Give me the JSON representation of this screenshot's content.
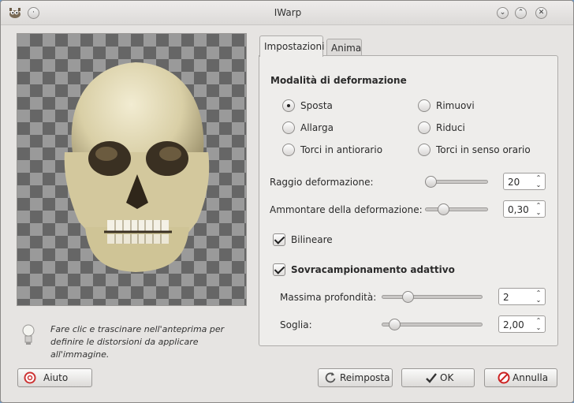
{
  "window": {
    "title": "IWarp"
  },
  "preview": {
    "hint": "Fare clic e trascinare nell'anteprima per definire le distorsioni da applicare all'immagine."
  },
  "tabs": [
    {
      "label": "Impostazioni",
      "active": true
    },
    {
      "label": "Anima",
      "active": false
    }
  ],
  "deform_mode": {
    "title": "Modalità di deformazione",
    "options": [
      {
        "label": "Sposta",
        "checked": true
      },
      {
        "label": "Rimuovi",
        "checked": false
      },
      {
        "label": "Allarga",
        "checked": false
      },
      {
        "label": "Riduci",
        "checked": false
      },
      {
        "label": "Torci in antiorario",
        "checked": false
      },
      {
        "label": "Torci in senso orario",
        "checked": false
      }
    ]
  },
  "radius": {
    "label": "Raggio deformazione:",
    "value": "20"
  },
  "amount": {
    "label": "Ammontare della deformazione:",
    "value": "0,30"
  },
  "bilinear": {
    "label": "Bilineare",
    "checked": true
  },
  "supersample": {
    "label": "Sovracampionamento adattivo",
    "checked": true,
    "max_depth": {
      "label": "Massima profondità:",
      "value": "2"
    },
    "threshold": {
      "label": "Soglia:",
      "value": "2,00"
    }
  },
  "buttons": {
    "help": "Aiuto",
    "reset": "Reimposta",
    "ok": "OK",
    "cancel": "Annulla"
  },
  "colors": {
    "window_bg": "#e6e4e2",
    "desktop_bg": "#6e98c4"
  }
}
